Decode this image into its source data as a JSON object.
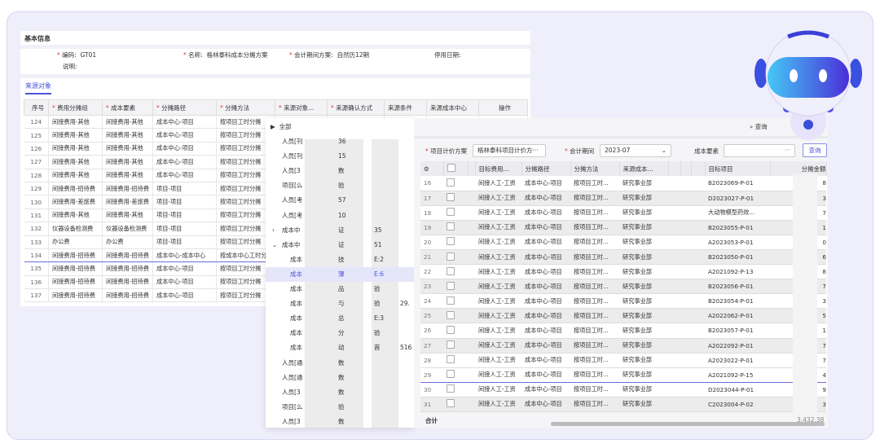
{
  "basic": {
    "title": "基本信息",
    "code_label": "编码:",
    "code": "GT01",
    "name_label": "名称:",
    "name": "格林泰科成本分摊方案",
    "period_label": "会计期间方案:",
    "period": "自然历12期",
    "stop_label": "停用日期:",
    "desc_label": "说明:"
  },
  "tab": "来源对象",
  "left_table": {
    "headers": [
      "序号",
      "费用分摊组",
      "成本要素",
      "分摊路径",
      "分摊方法",
      "来源对象...",
      "来源确认方式",
      "来源条件",
      "来源成本中心",
      "操作"
    ],
    "required": [
      false,
      true,
      true,
      true,
      true,
      true,
      true,
      false,
      false,
      false
    ],
    "rows": [
      [
        "124",
        "间接费用-其他",
        "间接费用-其他",
        "成本中心-项目",
        "按项目工时分摊"
      ],
      [
        "125",
        "间接费用-其他",
        "间接费用-其他",
        "成本中心-项目",
        "按项目工时分摊"
      ],
      [
        "126",
        "间接费用-其他",
        "间接费用-其他",
        "成本中心-项目",
        "按项目工时分摊"
      ],
      [
        "127",
        "间接费用-其他",
        "间接费用-其他",
        "成本中心-项目",
        "按项目工时分摊"
      ],
      [
        "128",
        "间接费用-其他",
        "间接费用-其他",
        "成本中心-项目",
        "按项目工时分摊"
      ],
      [
        "129",
        "间接费用-招待费",
        "间接费用-招待费",
        "项目-项目",
        "按项目工时分摊"
      ],
      [
        "130",
        "间接费用-差旅费",
        "间接费用-差旅费",
        "项目-项目",
        "按项目工时分摊"
      ],
      [
        "131",
        "间接费用-其他",
        "间接费用-其他",
        "项目-项目",
        "按项目工时分摊"
      ],
      [
        "132",
        "仪器设备检测费",
        "仪器设备检测费",
        "项目-项目",
        "按项目工时分摊"
      ],
      [
        "133",
        "办公费",
        "办公费",
        "项目-项目",
        "按项目工时分摊"
      ],
      [
        "134",
        "间接费用-招待费",
        "间接费用-招待费",
        "成本中心-成本中心",
        "按成本中心工时分摊"
      ],
      [
        "135",
        "间接费用-招待费",
        "间接费用-招待费",
        "成本中心-项目",
        "按项目工时分摊"
      ],
      [
        "136",
        "间接费用-招待费",
        "间接费用-招待费",
        "成本中心-项目",
        "按项目工时分摊"
      ],
      [
        "137",
        "间接费用-招待费",
        "间接费用-招待费",
        "成本中心-项目",
        "按项目工时分摊"
      ]
    ],
    "selected_row": "134"
  },
  "tree": {
    "root": "全部",
    "items": [
      {
        "label": "人员[刊",
        "c2": "36",
        "c3": "",
        "c4": "",
        "level": 1
      },
      {
        "label": "人员[刊",
        "c2": "15",
        "c3": "",
        "c4": "",
        "level": 1
      },
      {
        "label": "人员[3",
        "c2": "数",
        "c3": "",
        "c4": "",
        "level": 1
      },
      {
        "label": "项目[么",
        "c2": "验",
        "c3": "",
        "c4": "",
        "level": 1
      },
      {
        "label": "人员[考",
        "c2": "57",
        "c3": "",
        "c4": "",
        "level": 1
      },
      {
        "label": "人员[考",
        "c2": "10",
        "c3": "",
        "c4": "",
        "level": 1
      },
      {
        "label": "成本中",
        "c2": "证",
        "c3": "35",
        "c4": "",
        "level": 1,
        "toggle": "›"
      },
      {
        "label": "成本中",
        "c2": "证",
        "c3": "51",
        "c4": "",
        "level": 1,
        "toggle": "⌄"
      },
      {
        "label": "成本",
        "c2": "技",
        "c3": "E:2",
        "c4": "",
        "level": 2
      },
      {
        "label": "成本",
        "c2": "薄",
        "c3": "E:6",
        "c4": "",
        "level": 2,
        "selected": true
      },
      {
        "label": "成本",
        "c2": "品",
        "c3": "验",
        "c4": "",
        "level": 2
      },
      {
        "label": "成本",
        "c2": "与",
        "c3": "验",
        "c4": "29.",
        "level": 2
      },
      {
        "label": "成本",
        "c2": "总",
        "c3": "E:3",
        "c4": "",
        "level": 2
      },
      {
        "label": "成本",
        "c2": "分",
        "c3": "验",
        "c4": "",
        "level": 2
      },
      {
        "label": "成本",
        "c2": "动",
        "c3": "首",
        "c4": "516",
        "level": 2
      },
      {
        "label": "人员[通",
        "c2": "数",
        "c3": "",
        "c4": "",
        "level": 1
      },
      {
        "label": "人员[通",
        "c2": "数",
        "c3": "",
        "c4": "",
        "level": 1
      },
      {
        "label": "人员[3",
        "c2": "数",
        "c3": "",
        "c4": "",
        "level": 1
      },
      {
        "label": "项目[么",
        "c2": "验",
        "c3": "",
        "c4": "",
        "level": 1
      },
      {
        "label": "人员[3",
        "c2": "数",
        "c3": "",
        "c4": "",
        "level": 1
      }
    ]
  },
  "right": {
    "search_label": "查询",
    "plan_label": "项目计价方案",
    "plan_value": "格林泰科项目计价方···",
    "period_label": "会计期间",
    "period_value": "2023-07",
    "element_label": "成本要素",
    "element_value": "···",
    "query_button": "查询",
    "headers": [
      "",
      "",
      "",
      "目标费用...",
      "分摊路径",
      "分摊方法",
      "来源成本...",
      "",
      "",
      "",
      "目标项目",
      "分摊金额"
    ],
    "rows": [
      [
        "16",
        "间接人工-工资",
        "成本中心-项目",
        "按项目工时...",
        "研究事业部",
        "B2023069-P-01",
        "8"
      ],
      [
        "17",
        "间接人工-工资",
        "成本中心-项目",
        "按项目工时...",
        "研究事业部",
        "D2023027-P-01",
        "3"
      ],
      [
        "18",
        "间接人工-工资",
        "成本中心-项目",
        "按项目工时...",
        "研究事业部",
        "大动物模型药效...",
        "7"
      ],
      [
        "19",
        "间接人工-工资",
        "成本中心-项目",
        "按项目工时...",
        "研究事业部",
        "B2023055-P-01",
        "1"
      ],
      [
        "20",
        "间接人工-工资",
        "成本中心-项目",
        "按项目工时...",
        "研究事业部",
        "A2023053-P-01",
        "0"
      ],
      [
        "21",
        "间接人工-工资",
        "成本中心-项目",
        "按项目工时...",
        "研究事业部",
        "B2023050-P-01",
        "6"
      ],
      [
        "22",
        "间接人工-工资",
        "成本中心-项目",
        "按项目工时...",
        "研究事业部",
        "A2021092-P-13",
        "8"
      ],
      [
        "23",
        "间接人工-工资",
        "成本中心-项目",
        "按项目工时...",
        "研究事业部",
        "B2023056-P-01",
        "7"
      ],
      [
        "24",
        "间接人工-工资",
        "成本中心-项目",
        "按项目工时...",
        "研究事业部",
        "B2023054-P-01",
        "3"
      ],
      [
        "25",
        "间接人工-工资",
        "成本中心-项目",
        "按项目工时...",
        "研究事业部",
        "A2022062-P-01",
        "5"
      ],
      [
        "26",
        "间接人工-工资",
        "成本中心-项目",
        "按项目工时...",
        "研究事业部",
        "B2023057-P-01",
        "1"
      ],
      [
        "27",
        "间接人工-工资",
        "成本中心-项目",
        "按项目工时...",
        "研究事业部",
        "A2022092-P-01",
        "7"
      ],
      [
        "28",
        "间接人工-工资",
        "成本中心-项目",
        "按项目工时...",
        "研究事业部",
        "A2023022-P-01",
        "7"
      ],
      [
        "29",
        "间接人工-工资",
        "成本中心-项目",
        "按项目工时...",
        "研究事业部",
        "A2021092-P-15",
        "4"
      ],
      [
        "30",
        "间接人工-工资",
        "成本中心-项目",
        "按项目工时...",
        "研究事业部",
        "D2023044-P-01",
        "9"
      ],
      [
        "31",
        "间接人工-工资",
        "成本中心-项目",
        "按项目工时...",
        "研究事业部",
        "C2023004-P-02",
        "3"
      ]
    ],
    "selected_row": "29",
    "total_label": "合计",
    "total_value": "3,432.38"
  },
  "colors": {
    "accent": "#4a55d8",
    "frame": "#efeefb",
    "required": "#e33"
  }
}
